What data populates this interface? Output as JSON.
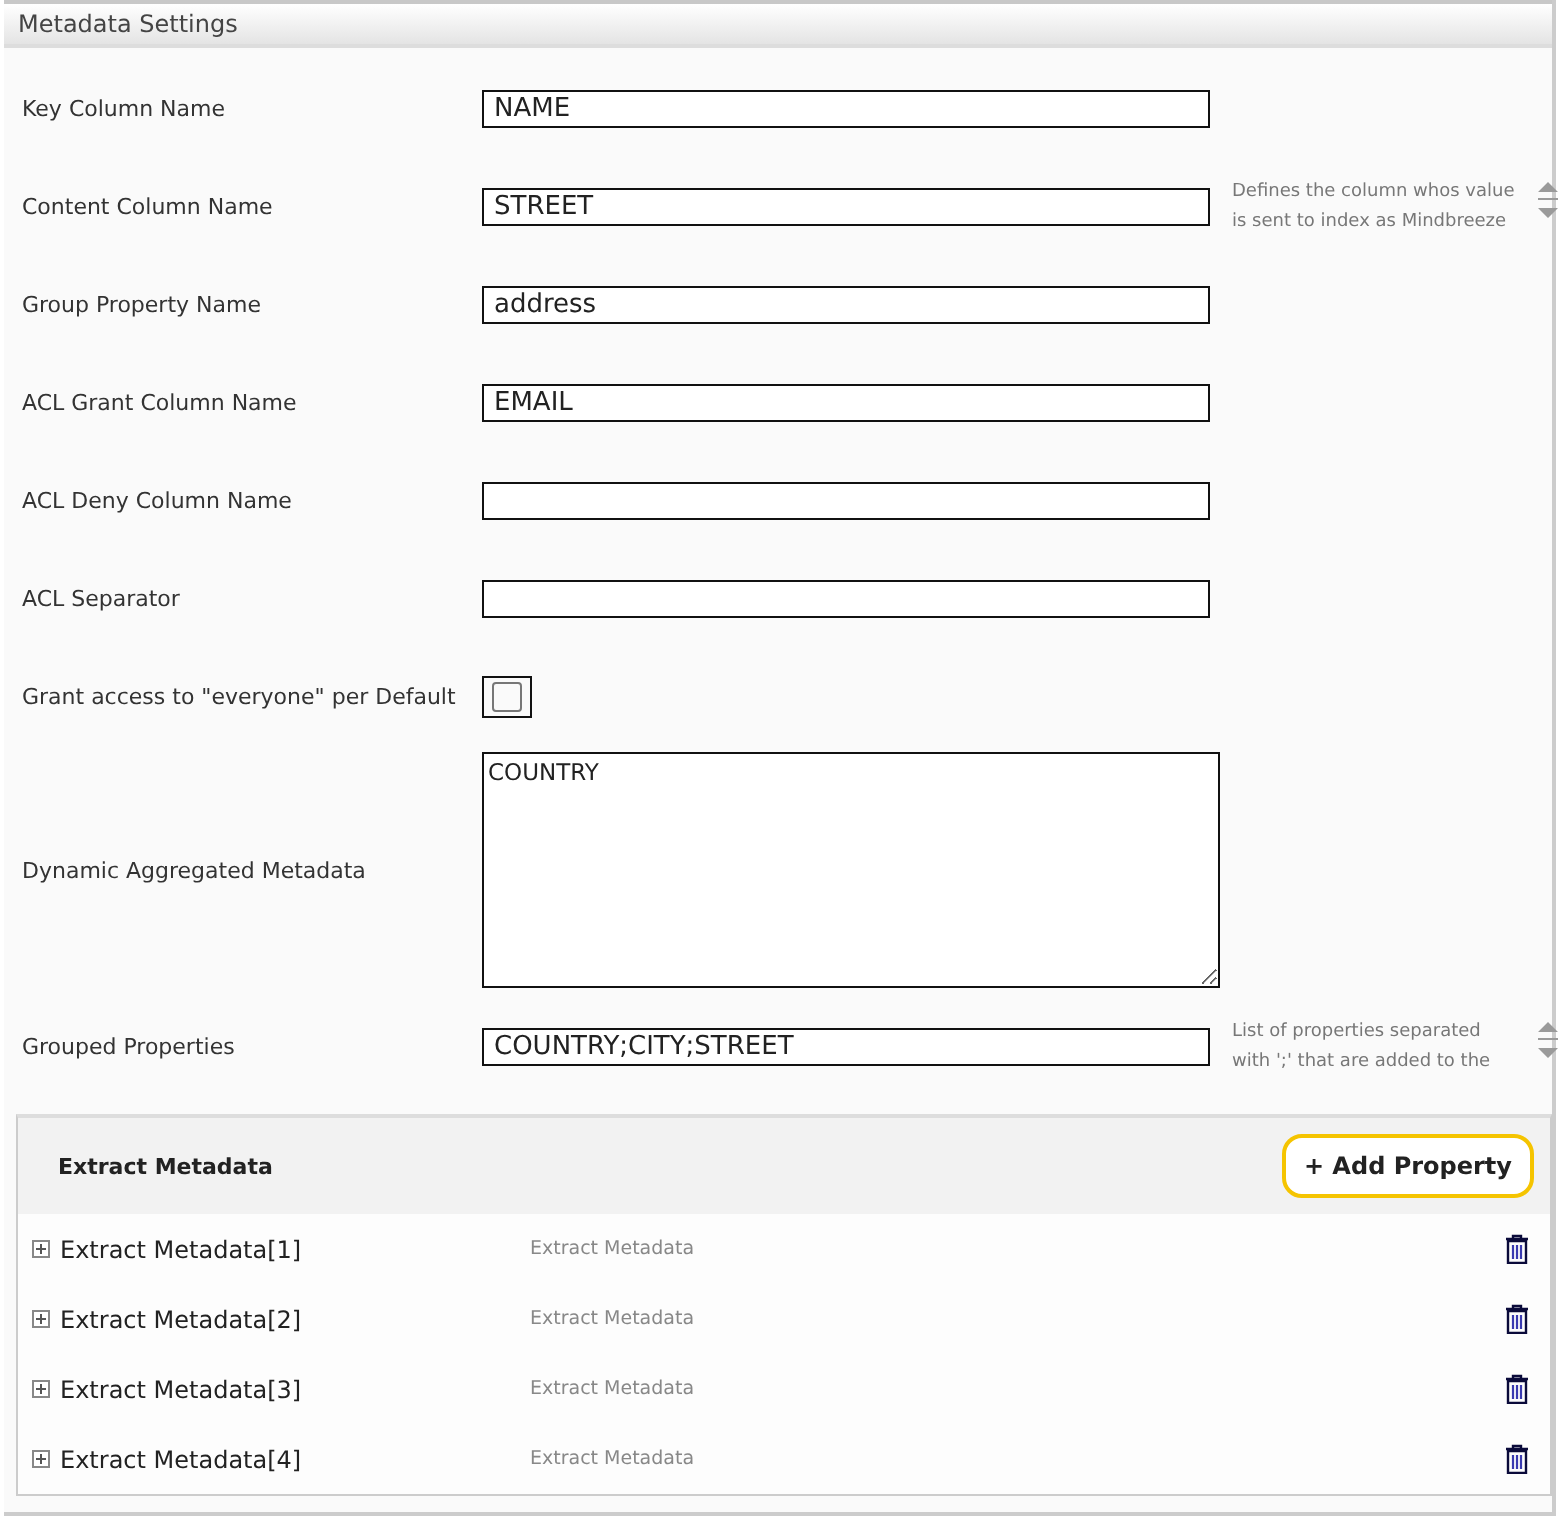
{
  "panel": {
    "title": "Metadata Settings"
  },
  "fields": [
    {
      "kind": "text",
      "label": "Key Column Name",
      "value": "NAME"
    },
    {
      "kind": "text",
      "label": "Content Column Name",
      "value": "STREET",
      "help_lines": [
        "Defines the column whos value",
        "is sent to index as Mindbreeze"
      ]
    },
    {
      "kind": "text",
      "label": "Group Property Name",
      "value": "address"
    },
    {
      "kind": "text",
      "label": "ACL Grant Column Name",
      "value": "EMAIL"
    },
    {
      "kind": "text",
      "label": "ACL Deny Column Name"
    },
    {
      "kind": "text",
      "label": "ACL Separator"
    },
    {
      "kind": "checkbox",
      "label": "Grant access to \"everyone\" per Default",
      "checked": false
    },
    {
      "kind": "textarea",
      "label": "Dynamic Aggregated Metadata",
      "value": "COUNTRY"
    },
    {
      "kind": "text",
      "label": "Grouped Properties",
      "value": "COUNTRY;CITY;STREET",
      "help_lines": [
        "List of properties separated",
        "with ';' that are added to the"
      ]
    }
  ],
  "extract": {
    "title": "Extract Metadata",
    "add_button": "+ Add Property",
    "items": [
      {
        "name": "Extract Metadata[1]",
        "type": "Extract Metadata",
        "expanded": false
      },
      {
        "name": "Extract Metadata[2]",
        "type": "Extract Metadata",
        "expanded": false
      },
      {
        "name": "Extract Metadata[3]",
        "type": "Extract Metadata",
        "expanded": false
      },
      {
        "name": "Extract Metadata[4]",
        "type": "Extract Metadata",
        "expanded": false
      }
    ]
  }
}
